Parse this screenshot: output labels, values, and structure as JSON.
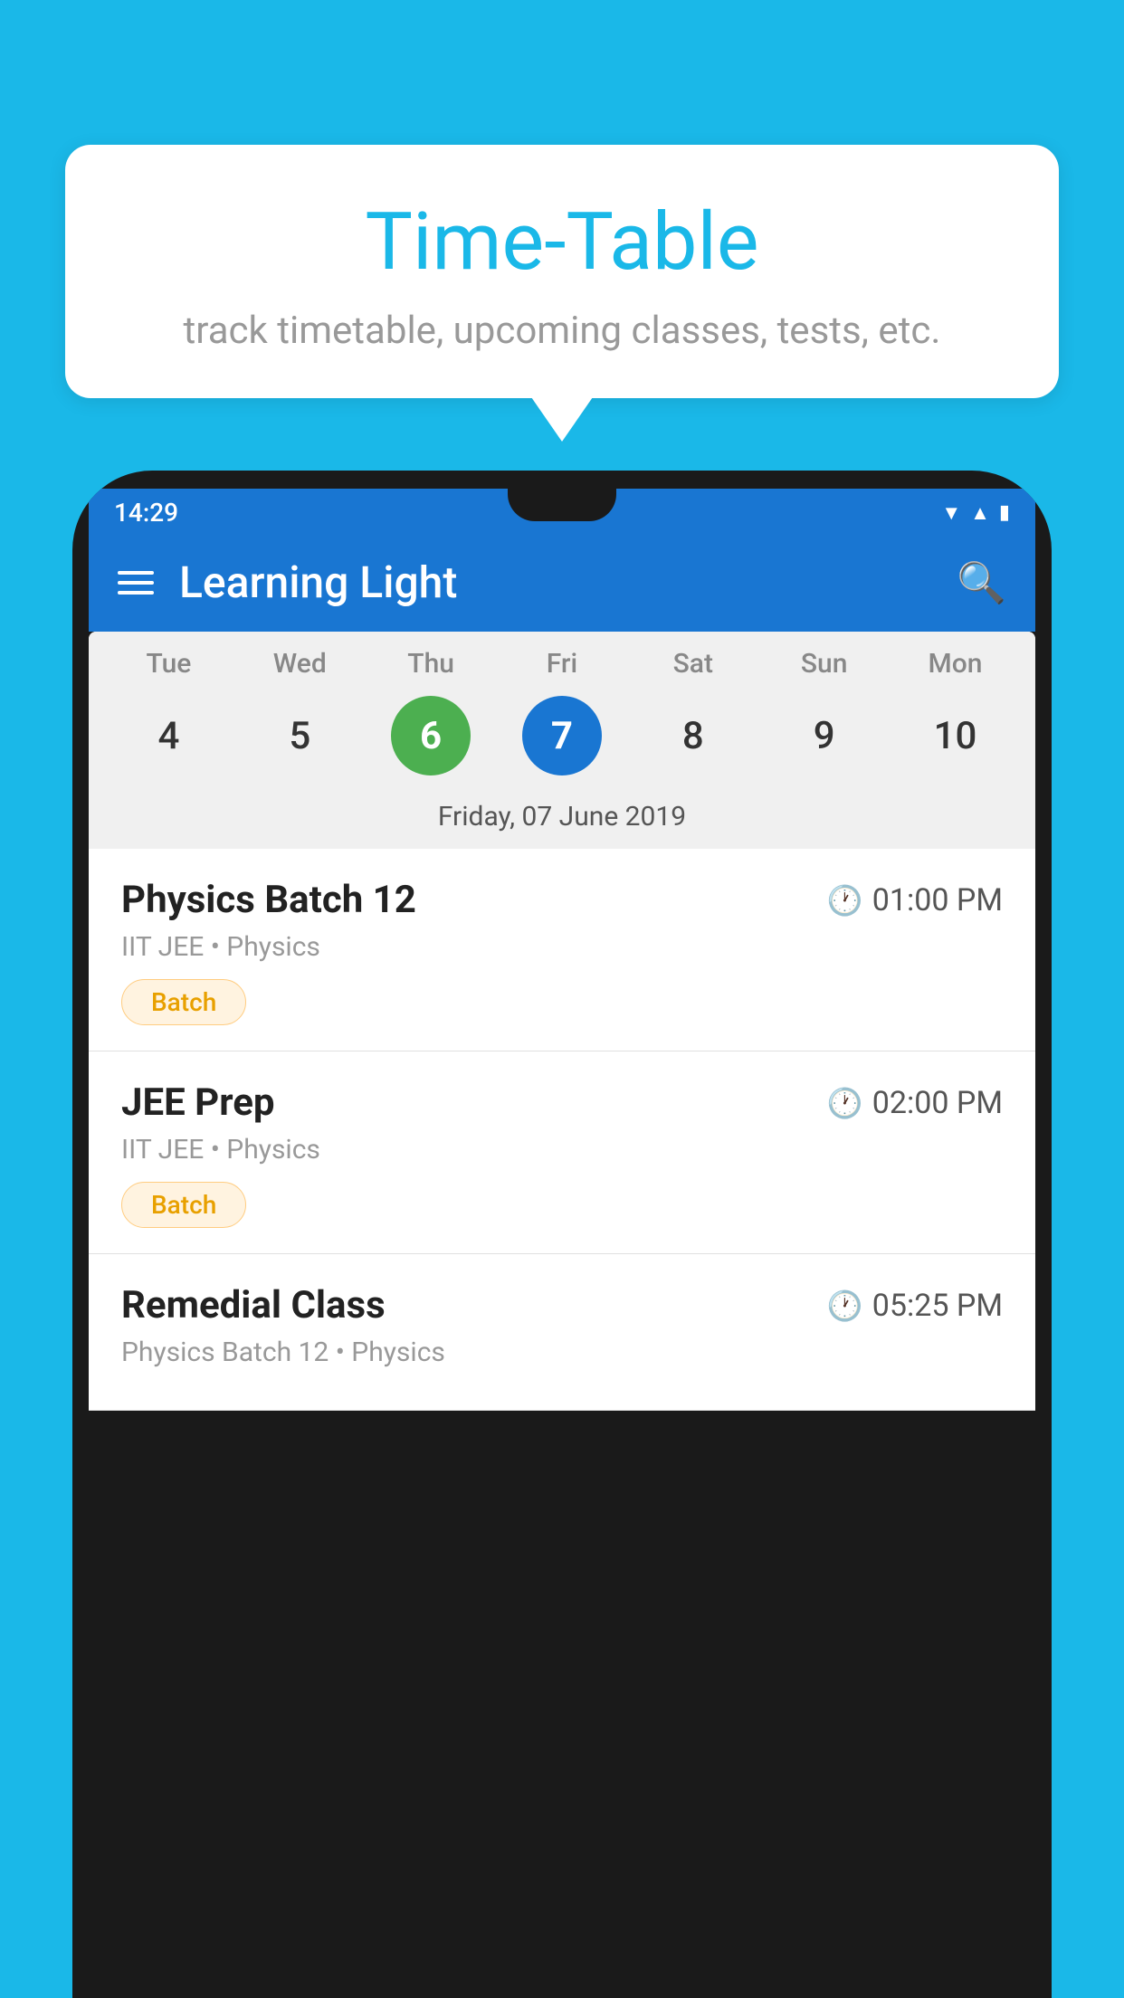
{
  "background": {
    "color": "#1ab8e8"
  },
  "bubble": {
    "title": "Time-Table",
    "subtitle": "track timetable, upcoming classes, tests, etc."
  },
  "phone": {
    "status_bar": {
      "time": "14:29"
    },
    "header": {
      "title": "Learning Light"
    },
    "calendar": {
      "days": [
        {
          "label": "Tue",
          "number": "4"
        },
        {
          "label": "Wed",
          "number": "5"
        },
        {
          "label": "Thu",
          "number": "6",
          "state": "today"
        },
        {
          "label": "Fri",
          "number": "7",
          "state": "selected"
        },
        {
          "label": "Sat",
          "number": "8"
        },
        {
          "label": "Sun",
          "number": "9"
        },
        {
          "label": "Mon",
          "number": "10"
        }
      ],
      "selected_date": "Friday, 07 June 2019"
    },
    "schedule": [
      {
        "name": "Physics Batch 12",
        "time": "01:00 PM",
        "subtitle": "IIT JEE • Physics",
        "tag": "Batch"
      },
      {
        "name": "JEE Prep",
        "time": "02:00 PM",
        "subtitle": "IIT JEE • Physics",
        "tag": "Batch"
      },
      {
        "name": "Remedial Class",
        "time": "05:25 PM",
        "subtitle": "Physics Batch 12 • Physics",
        "tag": ""
      }
    ]
  }
}
